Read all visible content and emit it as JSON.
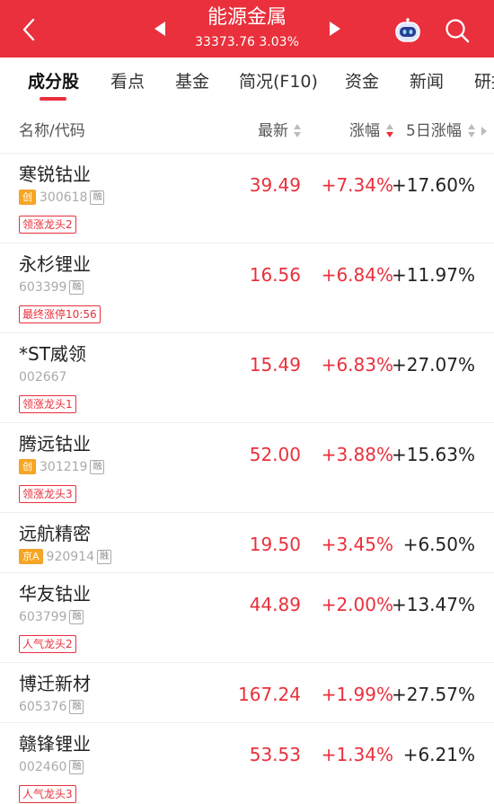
{
  "header": {
    "title": "能源金属",
    "index_value": "33373.76",
    "index_change": "3.03%"
  },
  "tabs": [
    "成分股",
    "看点",
    "基金",
    "简况(F10)",
    "资金",
    "新闻",
    "研报"
  ],
  "columns": {
    "name_code": "名称/代码",
    "latest": "最新",
    "change": "涨幅",
    "change5d": "5日涨幅"
  },
  "colors": {
    "accent": "#e9303c",
    "board_badge": "#f6a623"
  },
  "stocks": [
    {
      "name": "寒锐钴业",
      "board": "创",
      "code": "300618",
      "margin": "融",
      "tag": "领涨龙头2",
      "price": "39.49",
      "change": "+7.34%",
      "change5d": "+17.60%"
    },
    {
      "name": "永杉锂业",
      "board": "",
      "code": "603399",
      "margin": "融",
      "tag": "最终涨停10:56",
      "price": "16.56",
      "change": "+6.84%",
      "change5d": "+11.97%"
    },
    {
      "name": "*ST威领",
      "board": "",
      "code": "002667",
      "margin": "",
      "tag": "领涨龙头1",
      "price": "15.49",
      "change": "+6.83%",
      "change5d": "+27.07%"
    },
    {
      "name": "腾远钴业",
      "board": "创",
      "code": "301219",
      "margin": "融",
      "tag": "领涨龙头3",
      "price": "52.00",
      "change": "+3.88%",
      "change5d": "+15.63%"
    },
    {
      "name": "远航精密",
      "board": "京A",
      "code": "920914",
      "margin": "融",
      "tag": "",
      "price": "19.50",
      "change": "+3.45%",
      "change5d": "+6.50%"
    },
    {
      "name": "华友钴业",
      "board": "",
      "code": "603799",
      "margin": "融",
      "tag": "人气龙头2",
      "price": "44.89",
      "change": "+2.00%",
      "change5d": "+13.47%"
    },
    {
      "name": "博迁新材",
      "board": "",
      "code": "605376",
      "margin": "融",
      "tag": "",
      "price": "167.24",
      "change": "+1.99%",
      "change5d": "+27.57%"
    },
    {
      "name": "赣锋锂业",
      "board": "",
      "code": "002460",
      "margin": "融",
      "tag": "人气龙头3",
      "price": "53.53",
      "change": "+1.34%",
      "change5d": "+6.21%"
    }
  ]
}
